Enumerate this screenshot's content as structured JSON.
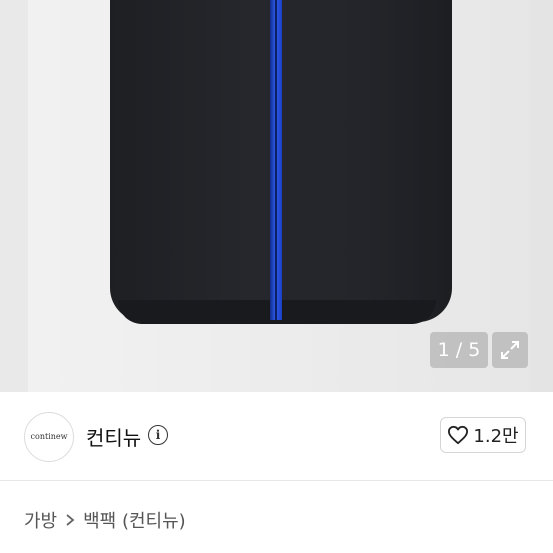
{
  "gallery": {
    "counter": "1 / 5",
    "expand_icon": "expand-icon"
  },
  "seller": {
    "avatar_text": "continew",
    "name": "컨티뉴",
    "info_icon": "info-icon"
  },
  "like": {
    "icon": "heart-icon",
    "count": "1.2만"
  },
  "breadcrumb": {
    "items": [
      "가방",
      "백팩 (컨티뉴)"
    ],
    "separator_icon": "chevron-right-icon"
  },
  "colors": {
    "bag": "#23252a",
    "zipper": "#2f5ce8",
    "gallery_bg": "#ececec"
  }
}
